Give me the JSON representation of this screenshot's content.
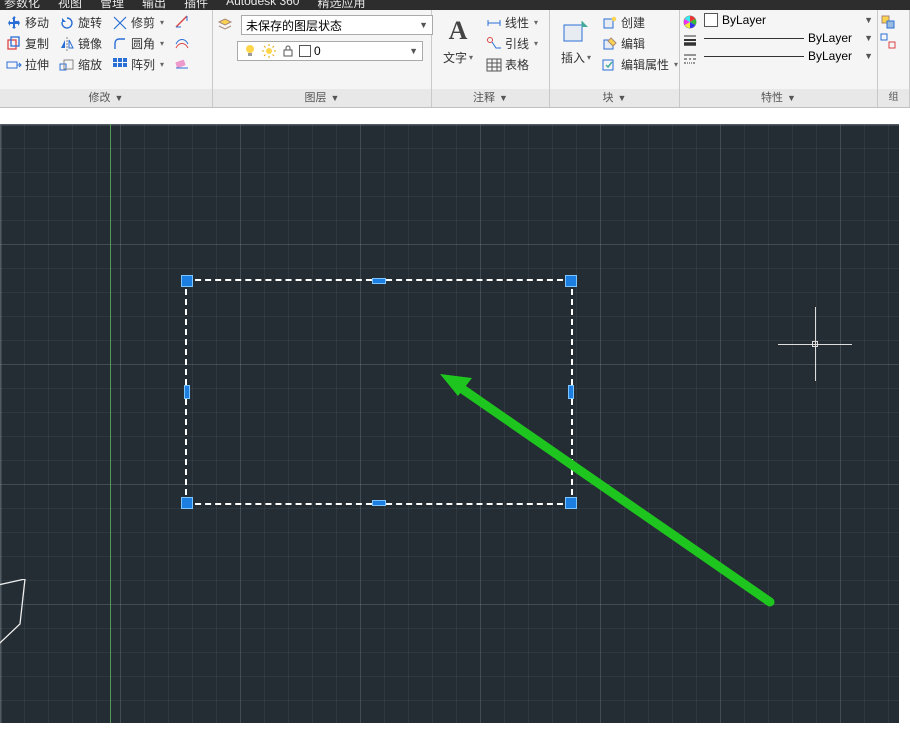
{
  "menu": {
    "m1": "参数化",
    "m2": "视图",
    "m3": "管理",
    "m4": "输出",
    "m5": "插件",
    "m6": "Autodesk 360",
    "m7": "精选应用"
  },
  "modify": {
    "title": "修改",
    "move": "移动",
    "rotate": "旋转",
    "trim": "修剪",
    "copy": "复制",
    "mirror": "镜像",
    "fillet": "圆角",
    "stretch": "拉伸",
    "scale": "缩放",
    "array": "阵列"
  },
  "layers": {
    "title": "图层",
    "state": "未保存的图层状态",
    "current": "0"
  },
  "annotation": {
    "title": "注释",
    "text": "文字",
    "linear": "线性",
    "leader": "引线",
    "table": "表格"
  },
  "block": {
    "title": "块",
    "insert": "插入",
    "create": "创建",
    "edit": "编辑",
    "editattr": "编辑属性"
  },
  "properties": {
    "title": "特性",
    "bylayer": "ByLayer"
  }
}
